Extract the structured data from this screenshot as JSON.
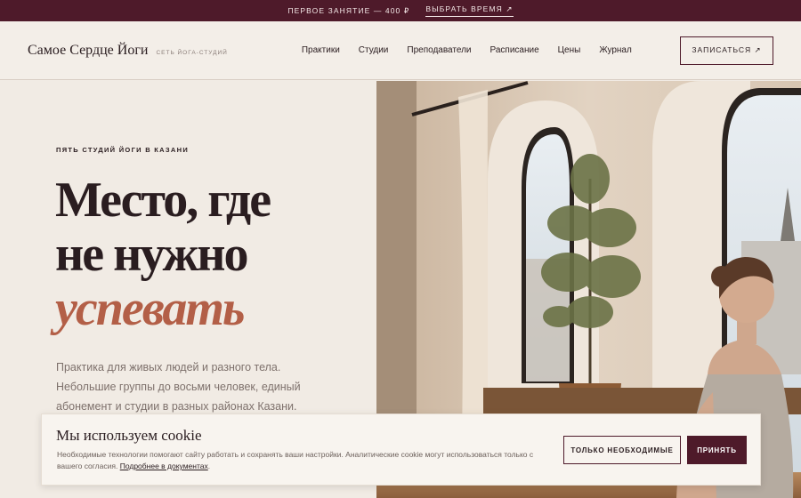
{
  "promo": {
    "text": "ПЕРВОЕ ЗАНЯТИЕ — 400 ₽",
    "link": "ВЫБРАТЬ ВРЕМЯ ↗"
  },
  "header": {
    "brand_name": "Самое Сердце Йоги",
    "brand_sub": "СЕТЬ ЙОГА-СТУДИЙ",
    "nav": [
      "Практики",
      "Студии",
      "Преподаватели",
      "Расписание",
      "Цены",
      "Журнал"
    ],
    "cta": "ЗАПИСАТЬСЯ ↗"
  },
  "hero": {
    "eyebrow": "ПЯТЬ СТУДИЙ ЙОГИ В КАЗАНИ",
    "headline_line1": "Место, где",
    "headline_line2": "не нужно",
    "headline_accent": "успевать",
    "lede": "Практика для живых людей и разного тела. Небольшие группы до восьми человек, единый абонемент и студии в разных районах Казани."
  },
  "cookie": {
    "title": "Мы используем cookie",
    "text": "Необходимые технологии помогают сайту работать и сохранять ваши настройки. Аналитические cookie могут использоваться только с вашего согласия.",
    "link": "Подробнее в документах",
    "link_suffix": ".",
    "btn_essential": "ТОЛЬКО НЕОБХОДИМЫЕ",
    "btn_accept": "ПРИНЯТЬ"
  },
  "colors": {
    "brand": "#4e1a2a",
    "accent": "#b35f47",
    "background": "#f1ebe4"
  }
}
